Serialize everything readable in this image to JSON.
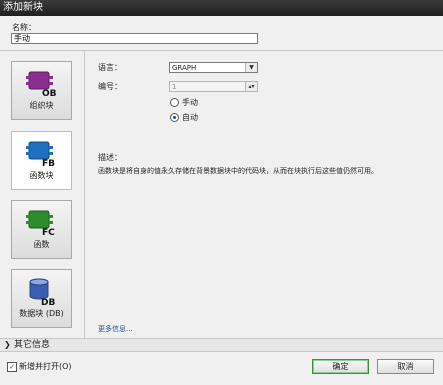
{
  "window": {
    "title": "添加新块"
  },
  "name": {
    "label": "名称：",
    "value": "手动"
  },
  "block_types": [
    {
      "badge": "OB",
      "label": "组织块",
      "color": "#8a2f8f"
    },
    {
      "badge": "FB",
      "label": "函数块",
      "color": "#1f6fbf"
    },
    {
      "badge": "FC",
      "label": "函数",
      "color": "#2e8b2e"
    },
    {
      "badge": "DB",
      "label": "数据块 (DB)",
      "color": "#3a5fb0"
    }
  ],
  "language": {
    "label": "语言：",
    "value": "GRAPH"
  },
  "number": {
    "label": "编号：",
    "value": "1"
  },
  "numbering": {
    "manual": "手动",
    "auto": "自动",
    "selected": "auto"
  },
  "description": {
    "title": "描述：",
    "text": "函数块是将自身的值永久存储在背景数据块中的代码块，从而在块执行后这些值仍然可用。"
  },
  "more_info": "更多信息...",
  "other_info": "其它信息",
  "footer": {
    "add_open_label": "新增并打开(O)",
    "add_open_checked": true,
    "ok": "确定",
    "cancel": "取消"
  }
}
